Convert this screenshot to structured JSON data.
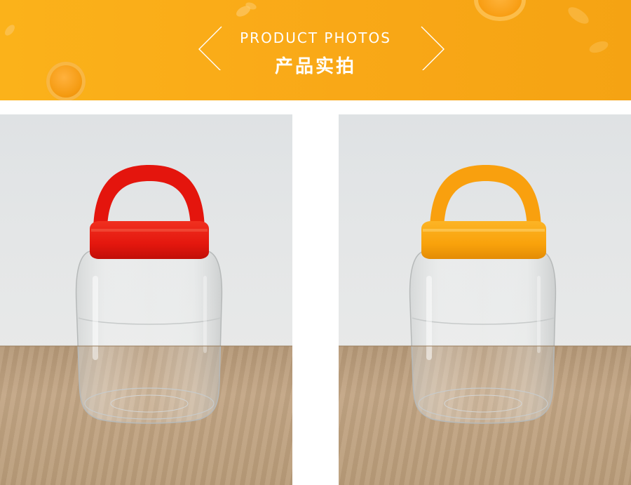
{
  "header": {
    "title_en": "PRODUCT PHOTOS",
    "title_cn": "产品实拍"
  },
  "colors": {
    "banner": "#f9a817",
    "lid_red": "#e5150f",
    "lid_orange": "#f9a20b"
  },
  "icons": {
    "left": "chevron-left-icon",
    "right": "chevron-right-icon"
  }
}
